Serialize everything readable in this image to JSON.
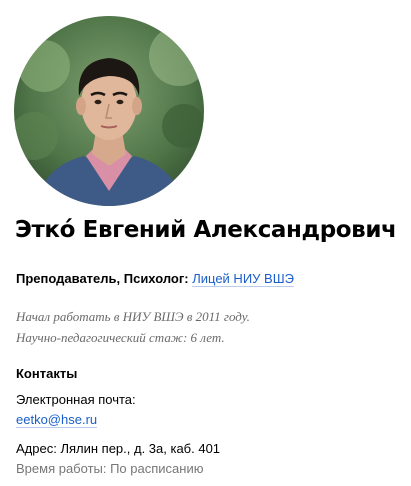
{
  "profile": {
    "photo_icon": "person-portrait-photo",
    "name": "Этко́ Евгений Александрович",
    "role": "Преподаватель, Психолог:",
    "organization": "Лицей НИУ ВШЭ",
    "bio": [
      "Начал работать в НИУ ВШЭ в 2011 году.",
      "Научно-педагогический стаж: 6 лет."
    ]
  },
  "contacts": {
    "heading": "Контакты",
    "email_label": "Электронная почта:",
    "email": "eetko@hse.ru",
    "address": "Адрес: Лялин пер., д. 3а, каб. 401",
    "hours": "Время работы: По расписанию"
  },
  "colors": {
    "link": "#1a5ec9",
    "muted_text": "#6a6a6a"
  }
}
